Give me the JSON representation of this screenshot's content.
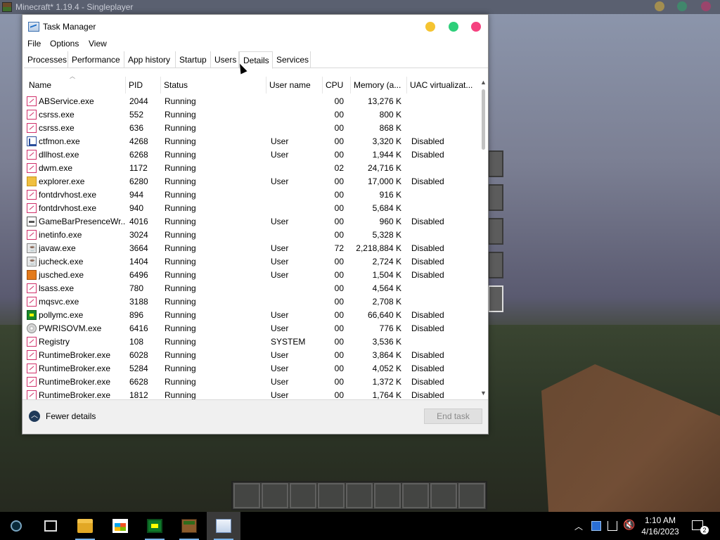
{
  "background": {
    "window_title": "Minecraft* 1.19.4 - Singleplayer"
  },
  "task_manager": {
    "title": "Task Manager",
    "menu": [
      "File",
      "Options",
      "View"
    ],
    "tabs": [
      "Processes",
      "Performance",
      "App history",
      "Startup",
      "Users",
      "Details",
      "Services"
    ],
    "active_tab": "Details",
    "columns": [
      "Name",
      "PID",
      "Status",
      "User name",
      "CPU",
      "Memory (a...",
      "UAC virtualizat..."
    ],
    "rows": [
      {
        "icon": "generic-process-icon",
        "name": "ABService.exe",
        "pid": "2044",
        "status": "Running",
        "user": "",
        "cpu": "00",
        "memory": "13,276 K",
        "uac": ""
      },
      {
        "icon": "generic-process-icon",
        "name": "csrss.exe",
        "pid": "552",
        "status": "Running",
        "user": "",
        "cpu": "00",
        "memory": "800 K",
        "uac": ""
      },
      {
        "icon": "generic-process-icon",
        "name": "csrss.exe",
        "pid": "636",
        "status": "Running",
        "user": "",
        "cpu": "00",
        "memory": "868 K",
        "uac": ""
      },
      {
        "icon": "ctfmon-icon",
        "name": "ctfmon.exe",
        "pid": "4268",
        "status": "Running",
        "user": "User",
        "cpu": "00",
        "memory": "3,320 K",
        "uac": "Disabled"
      },
      {
        "icon": "generic-process-icon",
        "name": "dllhost.exe",
        "pid": "6268",
        "status": "Running",
        "user": "User",
        "cpu": "00",
        "memory": "1,944 K",
        "uac": "Disabled"
      },
      {
        "icon": "generic-process-icon",
        "name": "dwm.exe",
        "pid": "1172",
        "status": "Running",
        "user": "",
        "cpu": "02",
        "memory": "24,716 K",
        "uac": ""
      },
      {
        "icon": "explorer-icon",
        "name": "explorer.exe",
        "pid": "6280",
        "status": "Running",
        "user": "User",
        "cpu": "00",
        "memory": "17,000 K",
        "uac": "Disabled"
      },
      {
        "icon": "generic-process-icon",
        "name": "fontdrvhost.exe",
        "pid": "944",
        "status": "Running",
        "user": "",
        "cpu": "00",
        "memory": "916 K",
        "uac": ""
      },
      {
        "icon": "generic-process-icon",
        "name": "fontdrvhost.exe",
        "pid": "940",
        "status": "Running",
        "user": "",
        "cpu": "00",
        "memory": "5,684 K",
        "uac": ""
      },
      {
        "icon": "gamebar-icon",
        "name": "GameBarPresenceWr...",
        "pid": "4016",
        "status": "Running",
        "user": "User",
        "cpu": "00",
        "memory": "960 K",
        "uac": "Disabled"
      },
      {
        "icon": "generic-process-icon",
        "name": "inetinfo.exe",
        "pid": "3024",
        "status": "Running",
        "user": "",
        "cpu": "00",
        "memory": "5,328 K",
        "uac": ""
      },
      {
        "icon": "java-icon",
        "name": "javaw.exe",
        "pid": "3664",
        "status": "Running",
        "user": "User",
        "cpu": "72",
        "memory": "2,218,884 K",
        "uac": "Disabled"
      },
      {
        "icon": "java-icon",
        "name": "jucheck.exe",
        "pid": "1404",
        "status": "Running",
        "user": "User",
        "cpu": "00",
        "memory": "2,724 K",
        "uac": "Disabled"
      },
      {
        "icon": "jusched-icon",
        "name": "jusched.exe",
        "pid": "6496",
        "status": "Running",
        "user": "User",
        "cpu": "00",
        "memory": "1,504 K",
        "uac": "Disabled"
      },
      {
        "icon": "generic-process-icon",
        "name": "lsass.exe",
        "pid": "780",
        "status": "Running",
        "user": "",
        "cpu": "00",
        "memory": "4,564 K",
        "uac": ""
      },
      {
        "icon": "generic-process-icon",
        "name": "mqsvc.exe",
        "pid": "3188",
        "status": "Running",
        "user": "",
        "cpu": "00",
        "memory": "2,708 K",
        "uac": ""
      },
      {
        "icon": "pollymc-icon",
        "name": "pollymc.exe",
        "pid": "896",
        "status": "Running",
        "user": "User",
        "cpu": "00",
        "memory": "66,640 K",
        "uac": "Disabled"
      },
      {
        "icon": "disc-icon",
        "name": "PWRISOVM.exe",
        "pid": "6416",
        "status": "Running",
        "user": "User",
        "cpu": "00",
        "memory": "776 K",
        "uac": "Disabled"
      },
      {
        "icon": "generic-process-icon",
        "name": "Registry",
        "pid": "108",
        "status": "Running",
        "user": "SYSTEM",
        "cpu": "00",
        "memory": "3,536 K",
        "uac": ""
      },
      {
        "icon": "generic-process-icon",
        "name": "RuntimeBroker.exe",
        "pid": "6028",
        "status": "Running",
        "user": "User",
        "cpu": "00",
        "memory": "3,864 K",
        "uac": "Disabled"
      },
      {
        "icon": "generic-process-icon",
        "name": "RuntimeBroker.exe",
        "pid": "5284",
        "status": "Running",
        "user": "User",
        "cpu": "00",
        "memory": "4,052 K",
        "uac": "Disabled"
      },
      {
        "icon": "generic-process-icon",
        "name": "RuntimeBroker.exe",
        "pid": "6628",
        "status": "Running",
        "user": "User",
        "cpu": "00",
        "memory": "1,372 K",
        "uac": "Disabled"
      },
      {
        "icon": "generic-process-icon",
        "name": "RuntimeBroker.exe",
        "pid": "1812",
        "status": "Running",
        "user": "User",
        "cpu": "00",
        "memory": "1,764 K",
        "uac": "Disabled"
      }
    ],
    "footer": {
      "fewer_details": "Fewer details",
      "end_task": "End task"
    },
    "colors": {
      "minimize": "#f5c431",
      "maximize": "#2ecf7a",
      "close": "#f5417f"
    }
  },
  "taskbar": {
    "apps": [
      "cortana-icon",
      "task-view-icon",
      "file-explorer-icon",
      "store-icon",
      "pollymc-icon",
      "minecraft-icon",
      "task-manager-icon"
    ],
    "clock_time": "1:10 AM",
    "clock_date": "4/16/2023"
  }
}
